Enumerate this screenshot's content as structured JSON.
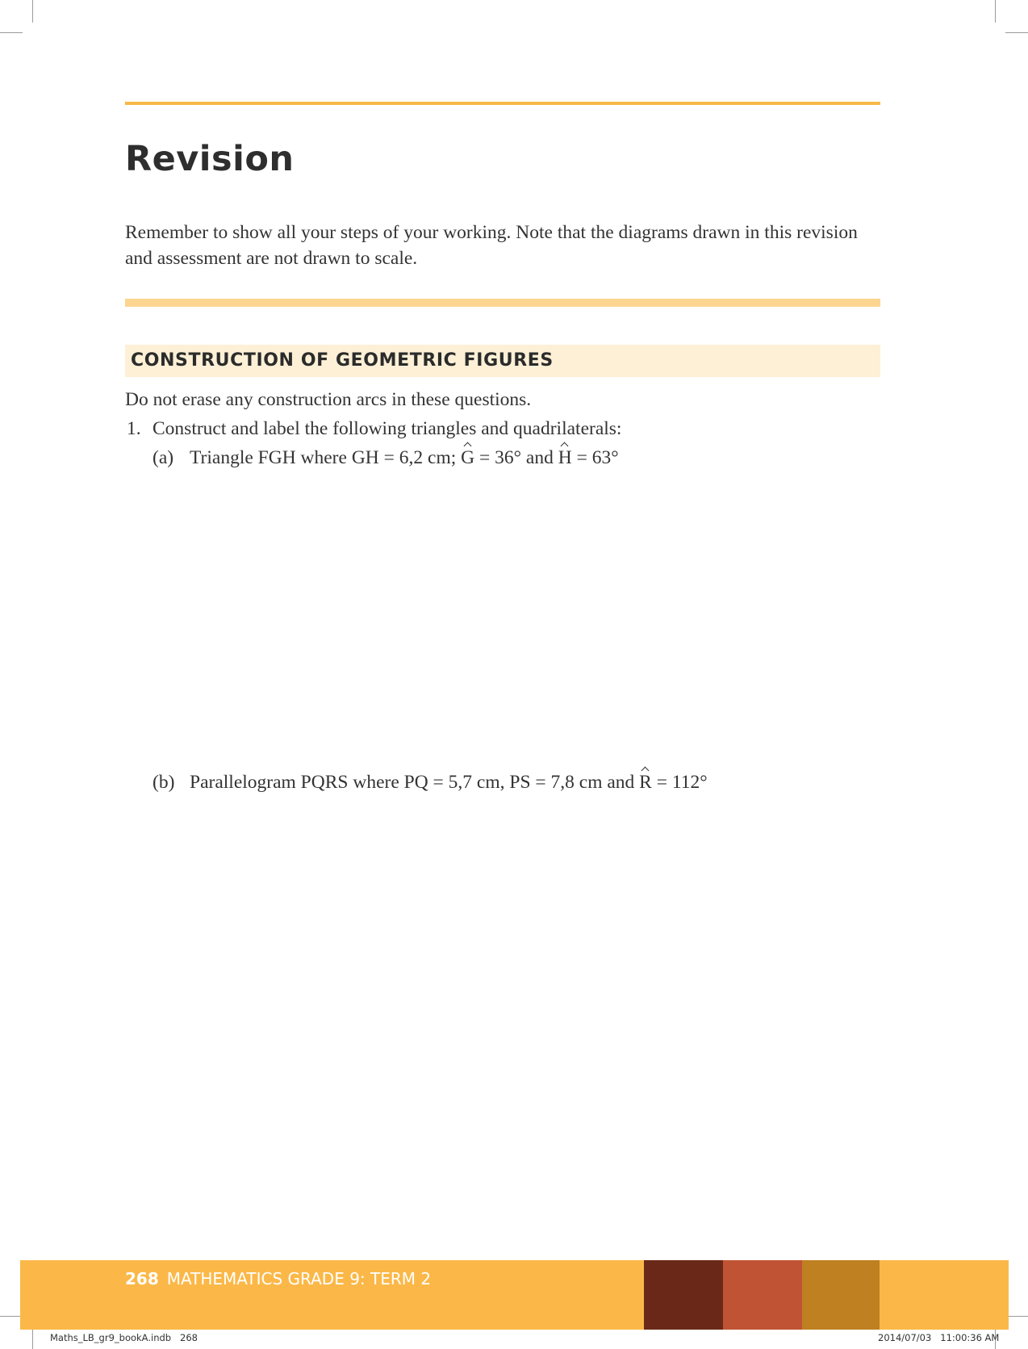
{
  "heading": "Revision",
  "intro": "Remember to show all your steps of your working. Note that the diagrams drawn in this revision and assessment are not drawn to scale.",
  "section_title": "CONSTRUCTION OF GEOMETRIC FIGURES",
  "instruction": "Do not erase any construction arcs in these questions.",
  "question1": {
    "number": "1.",
    "text": "Construct and label the following triangles and quadrilaterals:",
    "part_a": {
      "label": "(a)",
      "text_1": "Triangle FGH where GH = 6,2 cm; ",
      "angle_1": "G",
      "text_2": " = 36° and ",
      "angle_2": "H",
      "text_3": " = 63°"
    },
    "part_b": {
      "label": "(b)",
      "text_1": "Parallelogram PQRS where PQ = 5,7 cm, PS = 7,8 cm and ",
      "angle_1": "R",
      "text_2": " = 112°"
    }
  },
  "footer": {
    "page_number": "268",
    "running_title": "MATHEMATICS GRADE 9: TERM 2",
    "colors": [
      "#fbb848",
      "#6a2918",
      "#c05334",
      "#be8020"
    ]
  },
  "slug": {
    "file": "Maths_LB_gr9_bookA.indb   268",
    "timestamp": "2014/07/03   11:00:36 AM"
  }
}
